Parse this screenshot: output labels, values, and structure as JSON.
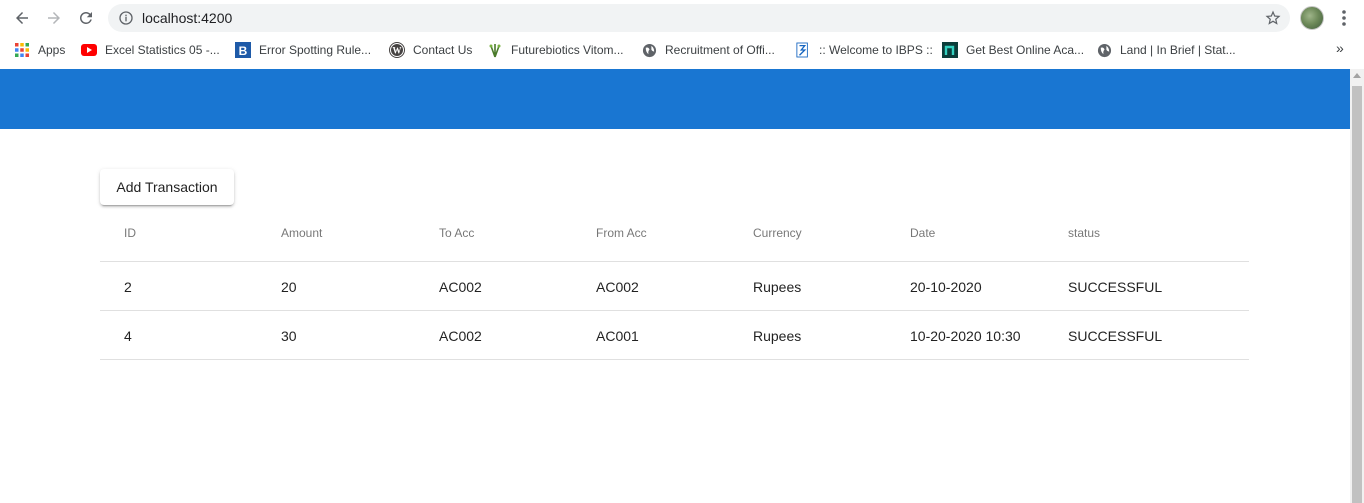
{
  "browser": {
    "url": "localhost:4200",
    "bookmarks": [
      {
        "label": "Apps",
        "icon": "apps-grid-icon"
      },
      {
        "label": "Excel Statistics 05 -...",
        "icon": "youtube-icon"
      },
      {
        "label": "Error Spotting Rule...",
        "icon": "blogger-b-icon"
      },
      {
        "label": "Contact Us",
        "icon": "wordpress-icon"
      },
      {
        "label": "Futurebiotics Vitom...",
        "icon": "leaf-icon"
      },
      {
        "label": "Recruitment of Offi...",
        "icon": "globe-icon"
      },
      {
        "label": ":: Welcome to IBPS ::",
        "icon": "ibps-icon"
      },
      {
        "label": "Get Best Online Aca...",
        "icon": "n-logo-icon"
      },
      {
        "label": "Land | In Brief | Stat...",
        "icon": "globe-icon"
      }
    ],
    "more_label": "»"
  },
  "app": {
    "header_color": "#1976d2",
    "add_button_label": "Add Transaction",
    "table": {
      "columns": [
        "ID",
        "Amount",
        "To Acc",
        "From Acc",
        "Currency",
        "Date",
        "status"
      ],
      "rows": [
        [
          "2",
          "20",
          "AC002",
          "AC002",
          "Rupees",
          "20-10-2020",
          "SUCCESSFUL"
        ],
        [
          "4",
          "30",
          "AC002",
          "AC001",
          "Rupees",
          "10-20-2020 10:30",
          "SUCCESSFUL"
        ]
      ]
    }
  }
}
